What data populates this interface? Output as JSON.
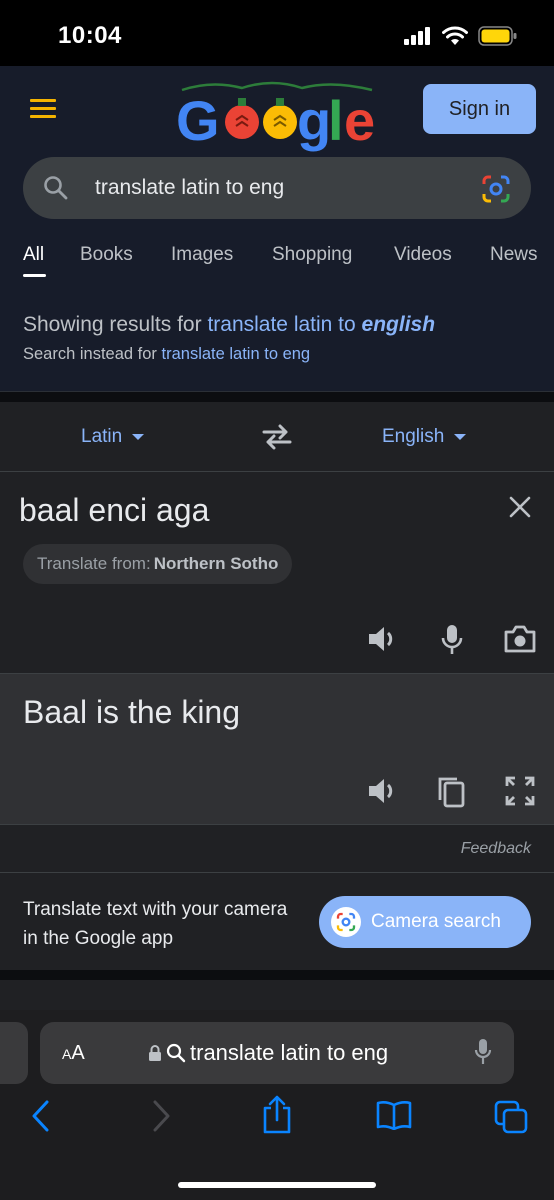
{
  "status": {
    "time": "10:04"
  },
  "header": {
    "logo": "Google",
    "signin_label": "Sign in"
  },
  "search": {
    "query": "translate latin to eng"
  },
  "tabs": [
    {
      "label": "All",
      "active": true
    },
    {
      "label": "Books"
    },
    {
      "label": "Images"
    },
    {
      "label": "Shopping"
    },
    {
      "label": "Videos"
    },
    {
      "label": "News"
    }
  ],
  "correction": {
    "showing_prefix": "Showing results for",
    "showing_link": "translate latin to",
    "showing_link_bold": "english",
    "instead_prefix": "Search instead for",
    "instead_link": "translate latin to eng"
  },
  "translator": {
    "source_lang": "Latin",
    "target_lang": "English",
    "source_text": "baal enci aga",
    "detect_prefix": "Translate from:",
    "detect_lang": "Northern Sotho",
    "target_text": "Baal is the king",
    "feedback": "Feedback"
  },
  "promo": {
    "text": "Translate text with your camera in the Google app",
    "button_label": "Camera search"
  },
  "safari": {
    "aa_label": "AA",
    "url_text": "translate latin to eng"
  },
  "colors": {
    "accent": "#8ab4f8",
    "header_bg": "#171c2a",
    "card_bg": "#202124",
    "hamburger": "#f5b400"
  }
}
